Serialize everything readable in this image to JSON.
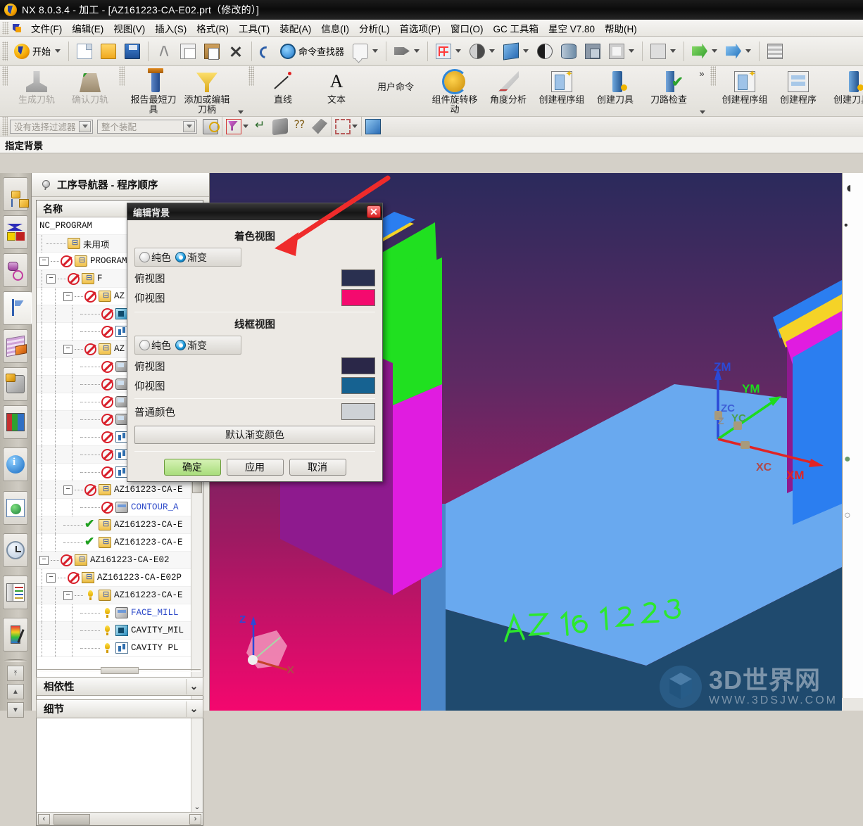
{
  "window": {
    "title": "NX 8.0.3.4 - 加工 - [AZ161223-CA-E02.prt（修改的）]",
    "logo_icon": "nx-logo-icon"
  },
  "menubar": {
    "grip_icon": "toolbar-grip-icon",
    "logo_icon": "nx-menu-logo-icon",
    "items": [
      "文件(F)",
      "编辑(E)",
      "视图(V)",
      "插入(S)",
      "格式(R)",
      "工具(T)",
      "装配(A)",
      "信息(I)",
      "分析(L)",
      "首选项(P)",
      "窗口(O)",
      "GC 工具箱",
      "星空 V7.80",
      "帮助(H)"
    ]
  },
  "toolbar_standard": {
    "start_label": "开始",
    "find_label": "命令查找器",
    "icons": [
      "start-icon",
      "new-file-icon",
      "open-file-icon",
      "save-icon",
      "cut-icon",
      "copy-icon",
      "paste-icon",
      "delete-icon",
      "undo-icon",
      "command-finder-icon",
      "balloon-note-icon",
      "tag-icon",
      "grid-snap-icon",
      "shaded-icon",
      "solid-cube-icon",
      "half-shade-icon",
      "cylinder-icon",
      "cubes-icon",
      "pale-face-icon",
      "square-icon",
      "move-green-icon",
      "move-blue-icon",
      "stack-icon"
    ]
  },
  "toolbar_big": {
    "buttons": [
      {
        "label": "生成刀轨",
        "icon": "generate-toolpath-icon",
        "disabled": true
      },
      {
        "label": "确认刀轨",
        "icon": "verify-toolpath-icon",
        "disabled": true
      },
      {
        "label": "报告最短刀具",
        "icon": "report-shortest-tool-icon",
        "disabled": false
      },
      {
        "label": "添加或编辑刀柄",
        "icon": "add-edit-holder-icon",
        "disabled": false
      },
      {
        "label": "直线",
        "icon": "line-icon",
        "disabled": false
      },
      {
        "label": "文本",
        "icon": "text-icon",
        "disabled": false
      },
      {
        "label": "用户命令",
        "icon": "user-command-icon",
        "disabled": false
      },
      {
        "label": "组件旋转移动",
        "icon": "component-rotate-move-icon",
        "disabled": false
      },
      {
        "label": "角度分析",
        "icon": "angle-analysis-icon",
        "disabled": false
      },
      {
        "label": "创建程序组",
        "icon": "create-program-group-icon",
        "disabled": false
      },
      {
        "label": "创建刀具",
        "icon": "create-tool-icon",
        "disabled": false
      },
      {
        "label": "刀路检查",
        "icon": "toolpath-check-icon",
        "disabled": false
      },
      {
        "label": "创建程序组",
        "icon": "create-program-group-icon-2",
        "disabled": false
      },
      {
        "label": "创建程序",
        "icon": "create-program-icon",
        "disabled": false
      },
      {
        "label": "创建刀具",
        "icon": "create-tool-icon-2",
        "disabled": false
      }
    ],
    "overflow_label": "»",
    "more_label": "▾"
  },
  "toolbar_select": {
    "filter_value": "没有选择过滤器",
    "scope_value": "整个装配",
    "icons": [
      "link-filter-icon",
      "red-selection-icon",
      "back-arrow-icon",
      "solid-body-icon",
      "query-icon",
      "wrench-icon",
      "dashed-rect-icon",
      "cube-view-icon"
    ],
    "dropdown_caret": "▾"
  },
  "cue": {
    "text": "指定背景"
  },
  "resource_bar": {
    "tabs": [
      {
        "name": "assembly-navigator",
        "icon": "assembly-navigator-icon",
        "active": false
      },
      {
        "name": "constraint-navigator",
        "icon": "constraint-navigator-icon",
        "active": false
      },
      {
        "name": "part-navigator",
        "icon": "part-navigator-icon",
        "active": false
      },
      {
        "name": "operation-navigator",
        "icon": "operation-navigator-icon",
        "active": true
      },
      {
        "name": "reuse-library",
        "icon": "reuse-library-icon",
        "active": false
      },
      {
        "name": "machining-wizard",
        "icon": "machining-wizard-icon",
        "active": false
      },
      {
        "name": "process-studio",
        "icon": "process-studio-icon",
        "active": false
      },
      {
        "name": "help-info",
        "icon": "info-icon",
        "active": false
      },
      {
        "name": "web-browser",
        "icon": "web-browser-icon",
        "active": false
      },
      {
        "name": "history",
        "icon": "clock-icon",
        "active": false
      },
      {
        "name": "palette",
        "icon": "palette-list-icon",
        "active": false
      },
      {
        "name": "color-picker",
        "icon": "color-picker-icon",
        "active": false
      }
    ],
    "buttons": [
      "scroll-top-icon",
      "scroll-up-icon",
      "scroll-down-icon"
    ]
  },
  "navigator": {
    "header": "工序导航器 - 程序顺序",
    "header_icon": "pin-icon",
    "column_header": "名称",
    "hscroll": {
      "left": "‹",
      "right": "›"
    },
    "vscroll_down": "⌄",
    "rows": [
      {
        "depth": 0,
        "expander": "",
        "status": "",
        "icon": "",
        "label": "NC_PROGRAM",
        "blue": false
      },
      {
        "depth": 1,
        "expander": "",
        "status": "",
        "icon": "folder",
        "label": "未用项",
        "blue": false
      },
      {
        "depth": 0,
        "expander": "−",
        "status": "no",
        "icon": "folder",
        "label": "PROGRAM",
        "blue": false
      },
      {
        "depth": 1,
        "expander": "−",
        "status": "no",
        "icon": "folder",
        "label": "F",
        "blue": false
      },
      {
        "depth": 2,
        "expander": "−",
        "status": "no",
        "icon": "folder",
        "label": "AZ",
        "blue": false
      },
      {
        "depth": 3,
        "expander": "",
        "status": "no",
        "icon": "op2",
        "label": "",
        "blue": false
      },
      {
        "depth": 3,
        "expander": "",
        "status": "no",
        "icon": "op3",
        "label": "",
        "blue": false
      },
      {
        "depth": 2,
        "expander": "−",
        "status": "no",
        "icon": "folder",
        "label": "AZ",
        "blue": false
      },
      {
        "depth": 3,
        "expander": "",
        "status": "no",
        "icon": "mill",
        "label": "",
        "blue": false
      },
      {
        "depth": 3,
        "expander": "",
        "status": "no",
        "icon": "mill",
        "label": "",
        "blue": false
      },
      {
        "depth": 3,
        "expander": "",
        "status": "no",
        "icon": "mill",
        "label": "",
        "blue": false
      },
      {
        "depth": 3,
        "expander": "",
        "status": "no",
        "icon": "mill",
        "label": "",
        "blue": false
      },
      {
        "depth": 3,
        "expander": "",
        "status": "no",
        "icon": "op3",
        "label": "",
        "blue": false
      },
      {
        "depth": 3,
        "expander": "",
        "status": "no",
        "icon": "op3",
        "label": "",
        "blue": false
      },
      {
        "depth": 3,
        "expander": "",
        "status": "no",
        "icon": "op3",
        "label": "",
        "blue": false
      },
      {
        "depth": 2,
        "expander": "−",
        "status": "no",
        "icon": "folder",
        "label": "AZ161223-CA-E",
        "blue": false
      },
      {
        "depth": 3,
        "expander": "",
        "status": "no",
        "icon": "op1",
        "label": "CONTOUR_A",
        "blue": true
      },
      {
        "depth": 2,
        "expander": "",
        "status": "ok",
        "icon": "folder",
        "label": "AZ161223-CA-E",
        "blue": false
      },
      {
        "depth": 2,
        "expander": "",
        "status": "ok",
        "icon": "folder",
        "label": "AZ161223-CA-E",
        "blue": false
      },
      {
        "depth": 0,
        "expander": "−",
        "status": "no",
        "icon": "folder2",
        "label": "AZ161223-CA-E02",
        "blue": false
      },
      {
        "depth": 1,
        "expander": "−",
        "status": "no",
        "icon": "folder2",
        "label": "AZ161223-CA-E02P",
        "blue": false
      },
      {
        "depth": 2,
        "expander": "−",
        "status": "warn",
        "icon": "folder",
        "label": "AZ161223-CA-E",
        "blue": false
      },
      {
        "depth": 3,
        "expander": "",
        "status": "warn",
        "icon": "op1",
        "label": "FACE_MILL",
        "blue": true
      },
      {
        "depth": 3,
        "expander": "",
        "status": "warn",
        "icon": "op2",
        "label": "CAVITY_MIL",
        "blue": false
      },
      {
        "depth": 3,
        "expander": "",
        "status": "warn",
        "icon": "op3",
        "label": "CAVITY PL",
        "blue": false
      }
    ],
    "panels": [
      {
        "label": "相依性",
        "chevron": "⌄"
      },
      {
        "label": "细节",
        "chevron": "⌄"
      }
    ]
  },
  "dialog": {
    "title": "编辑背景",
    "close_icon": "close-icon",
    "sections": [
      {
        "heading": "着色视图",
        "solid_label": "纯色",
        "gradient_label": "渐变",
        "selected": "gradient",
        "top_label": "俯视图",
        "bottom_label": "仰视图",
        "top_color": "#2a3050",
        "bottom_color": "#f40a6e"
      },
      {
        "heading": "线框视图",
        "solid_label": "纯色",
        "gradient_label": "渐变",
        "selected": "gradient",
        "top_label": "俯视图",
        "bottom_label": "仰视图",
        "top_color": "#2a2748",
        "bottom_color": "#166291"
      }
    ],
    "plain_color_label": "普通颜色",
    "plain_color": "#ced2d6",
    "default_gradient_label": "默认渐变颜色",
    "buttons": [
      {
        "label": "确定",
        "primary": true
      },
      {
        "label": "应用",
        "primary": false
      },
      {
        "label": "取消",
        "primary": false
      }
    ]
  },
  "viewport": {
    "triad": {
      "zm": "ZM",
      "ym": "YM",
      "xm": "XM",
      "zc": "ZC",
      "yc": "YC",
      "xc": "XC",
      "z": "Z",
      "zm_color": "#2b49d6",
      "ym_color": "#1ddc1d",
      "xm_color": "#e02424"
    },
    "csys_gizmo": {
      "z": "Z",
      "x": "X"
    },
    "engraved_text": "AZ161223",
    "engraved_color": "#2ce82c",
    "colors": {
      "background_top": "#2b2a5c",
      "background_bottom": "#f4076e",
      "base_block": "#69a9ef",
      "base_block_dark": "#1f4a6e",
      "rib_magenta": "#e01ce0",
      "rib_purple": "#8e1a8e",
      "face_green": "#20e020",
      "face_blue": "#2b7ef0",
      "face_yellow": "#f5d327"
    },
    "watermark": {
      "brand": "3D世界网",
      "url": "WWW.3DSJW.COM",
      "logo_icon": "cube-hex-logo-icon"
    }
  },
  "right_panel": {
    "glyphs": [
      "◖",
      "•",
      "●",
      "○"
    ]
  }
}
